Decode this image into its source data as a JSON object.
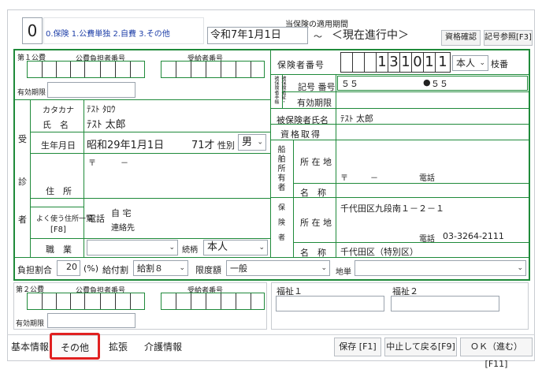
{
  "header": {
    "type_value": "0",
    "type_options": "0.保険  1.公費単独  2.自費  3.その他",
    "period_label": "当保険の適用期間",
    "start_date": "令和7年1月1日",
    "tilde": "～",
    "end_text": "＜現在進行中＞",
    "qual_check_button": "資格確認",
    "record_ref_button": "記号参照[F3]"
  },
  "kohi1": {
    "label": "第１公費",
    "payer_label": "公費負担者番号",
    "recipient_label": "受給者番号",
    "valid_label": "有効期限"
  },
  "insurer": {
    "number_label": "保険者番号",
    "number_digits": [
      "",
      "",
      "",
      "1",
      "3",
      "1",
      "0",
      "1",
      "1"
    ],
    "relation": "本人",
    "branch_label": "枝番",
    "card_type_vertical": "被保険者証・被保険者手帳",
    "symbol_label": "記号 番号",
    "symbol_value": "５５",
    "bullet": "●",
    "number_value": "５５",
    "valid_label": "有効期限",
    "holder_label": "被保険者氏名",
    "holder_value": "ﾃｽﾄ 太郎",
    "acquire_label": "資格取得"
  },
  "patient": {
    "section_label": [
      "受",
      "診",
      "者"
    ],
    "kana_label": "カタカナ",
    "kana_value": "ﾃｽﾄ ﾀﾛｳ",
    "name_label": "氏　名",
    "name_value": "ﾃｽﾄ 太郎",
    "birth_label": "生年月日",
    "birth_value": "昭和29年1月1日",
    "age_value": "71才",
    "sex_label": "性別",
    "sex_value": "男",
    "address_label": "住　所",
    "postal_mark": "〒",
    "postal_dash": "－",
    "frequent_addr_label": "よく使う住所一覧",
    "frequent_addr_key": "[F8]",
    "phone_label": "電話",
    "phone_home": "自 宅",
    "phone_contact": "連絡先",
    "job_label": "職　業",
    "relation_label": "続柄",
    "relation_value": "本人"
  },
  "ship_owner": {
    "vertical_label": "船舶所有者",
    "address_label": "所 在 地",
    "postal_mark": "〒",
    "postal_dash": "－",
    "phone_label": "電話",
    "name_label": "名　称"
  },
  "insurer_info": {
    "vertical_label": "保険者",
    "address_label": "所 在 地",
    "address_value": "千代田区九段南１－２－１",
    "phone_label": "電話",
    "phone_value": "03-3264-2111",
    "name_label": "名　称",
    "name_value": "千代田区（特別区）"
  },
  "burden": {
    "ratio_label": "負担割合",
    "ratio_value": "20",
    "ratio_unit": "(%)",
    "benefit_label": "給付割",
    "benefit_value": "給割８",
    "limit_label": "限度額",
    "limit_value": "一般",
    "region_label": "地単",
    "region_value": ""
  },
  "kohi2": {
    "label": "第２公費",
    "payer_label": "公費負担者番号",
    "recipient_label": "受給者番号",
    "valid_label": "有効期限"
  },
  "welfare": {
    "label1": "福祉１",
    "label2": "福祉２"
  },
  "tabs": [
    "基本情報",
    "その他",
    "拡張",
    "介護情報"
  ],
  "footer_buttons": [
    "保存 [F1]",
    "中止して戻る[F9]",
    "ＯＫ（進む）[F11]"
  ]
}
